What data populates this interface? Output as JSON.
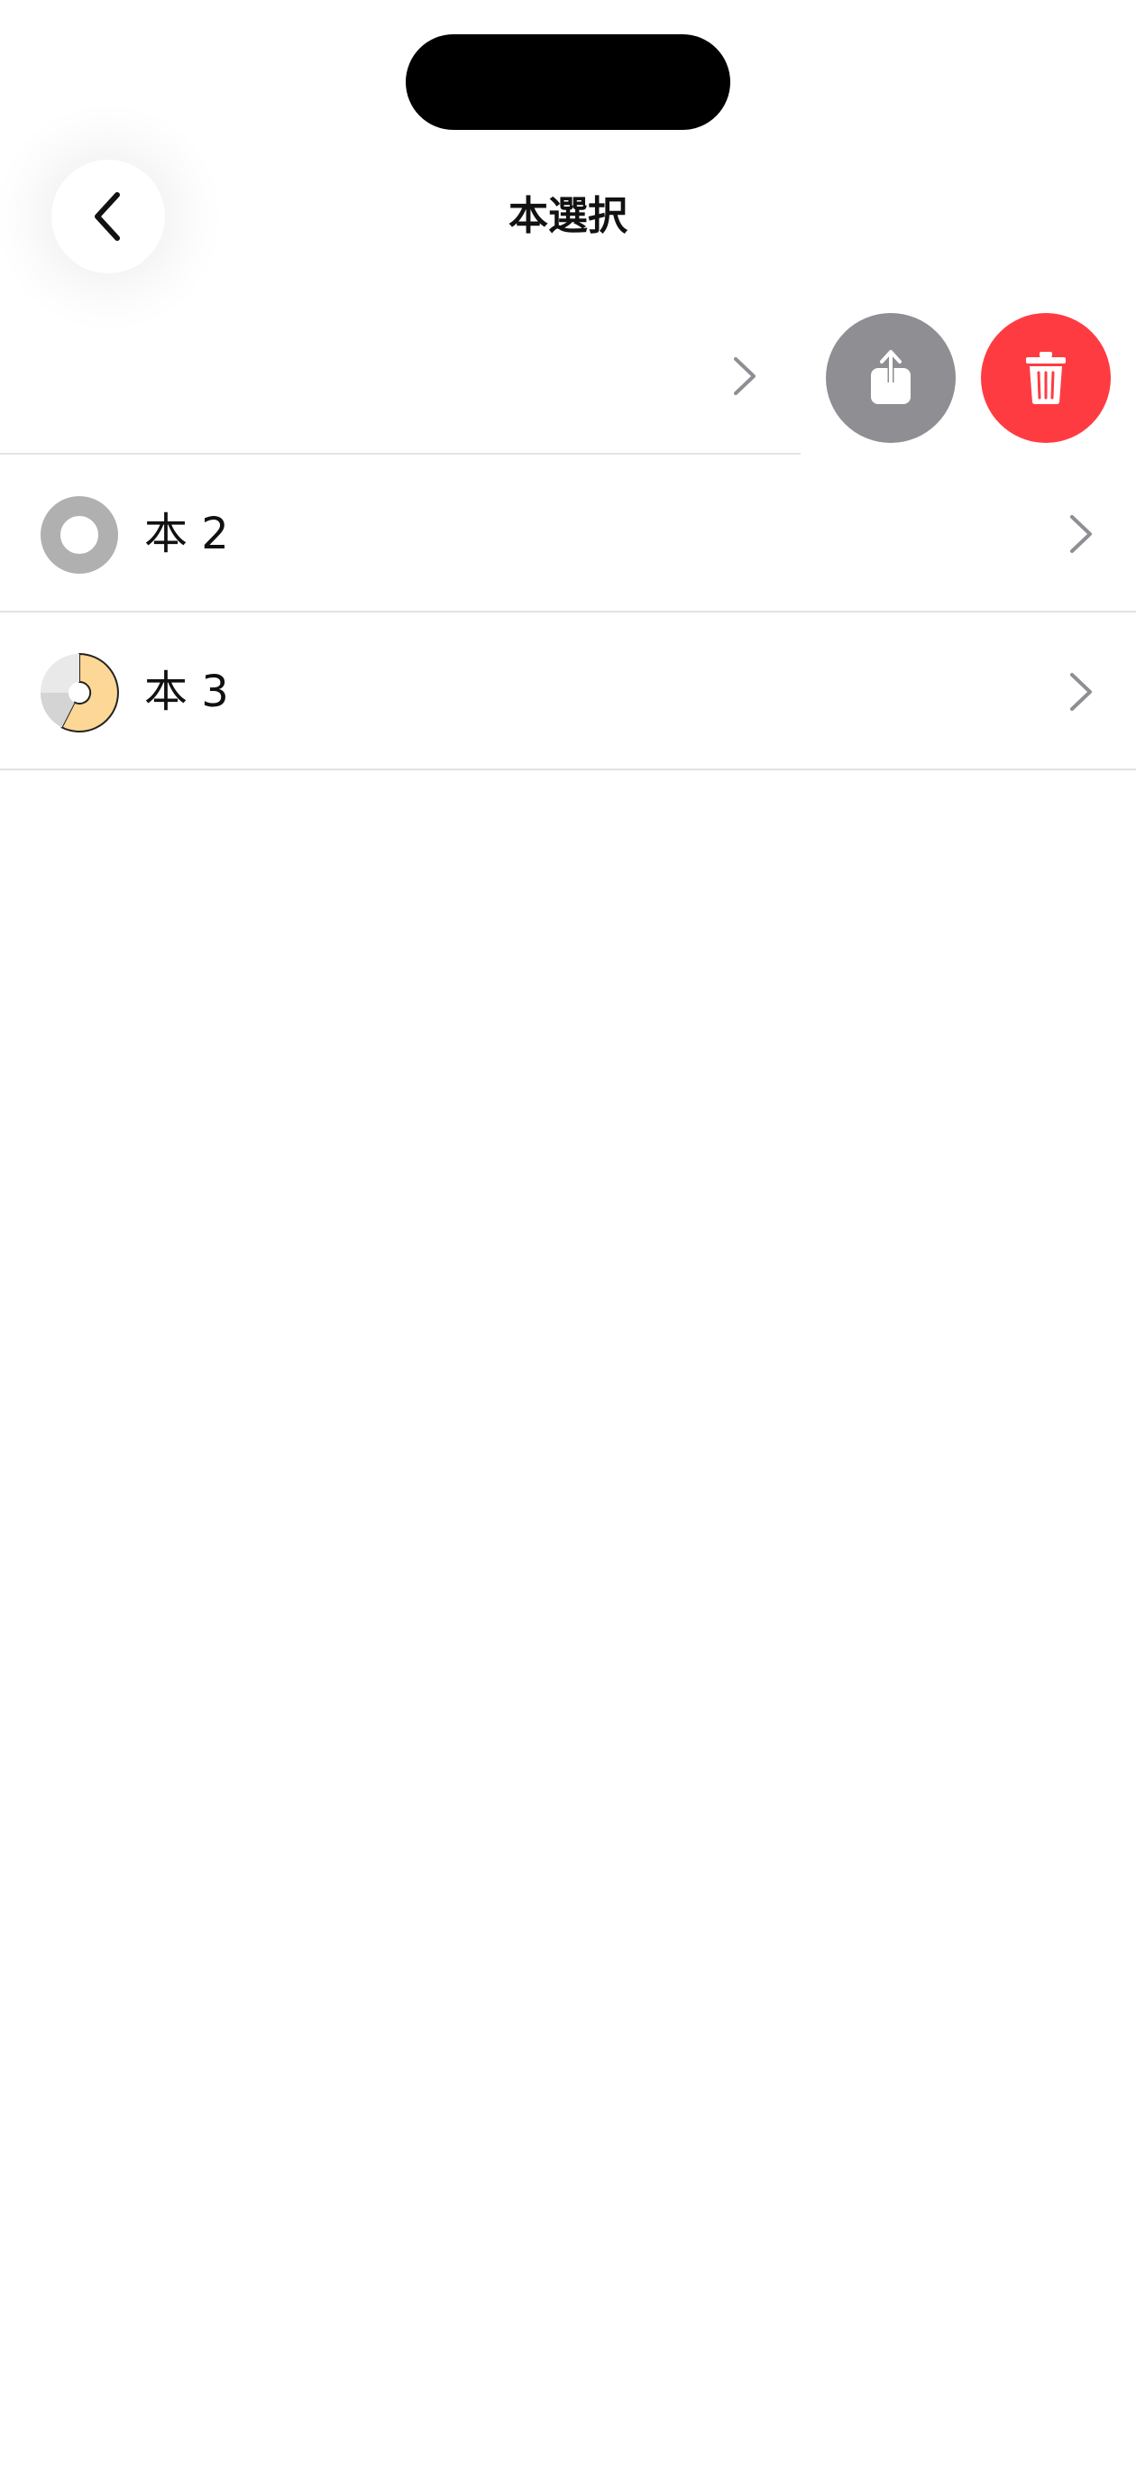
{
  "header": {
    "title": "本選択",
    "back_icon": "chevron-left-icon"
  },
  "swiped_row": {
    "chevron_icon": "chevron-right-icon",
    "actions": [
      {
        "name": "share",
        "icon": "share-icon",
        "color": "#8e8e93"
      },
      {
        "name": "delete",
        "icon": "trash-icon",
        "color": "#ff3b42"
      }
    ]
  },
  "books": [
    {
      "label": "本 2",
      "progress_icon": "empty-progress-ring-icon",
      "progress": 0
    },
    {
      "label": "本 3",
      "progress_icon": "partial-progress-ring-icon",
      "progress": 0.58
    }
  ],
  "colors": {
    "progress_fill": "#fdd795",
    "progress_empty": "#b0b0b0",
    "divider": "#e3e3e5",
    "chevron": "#8e8e93"
  }
}
